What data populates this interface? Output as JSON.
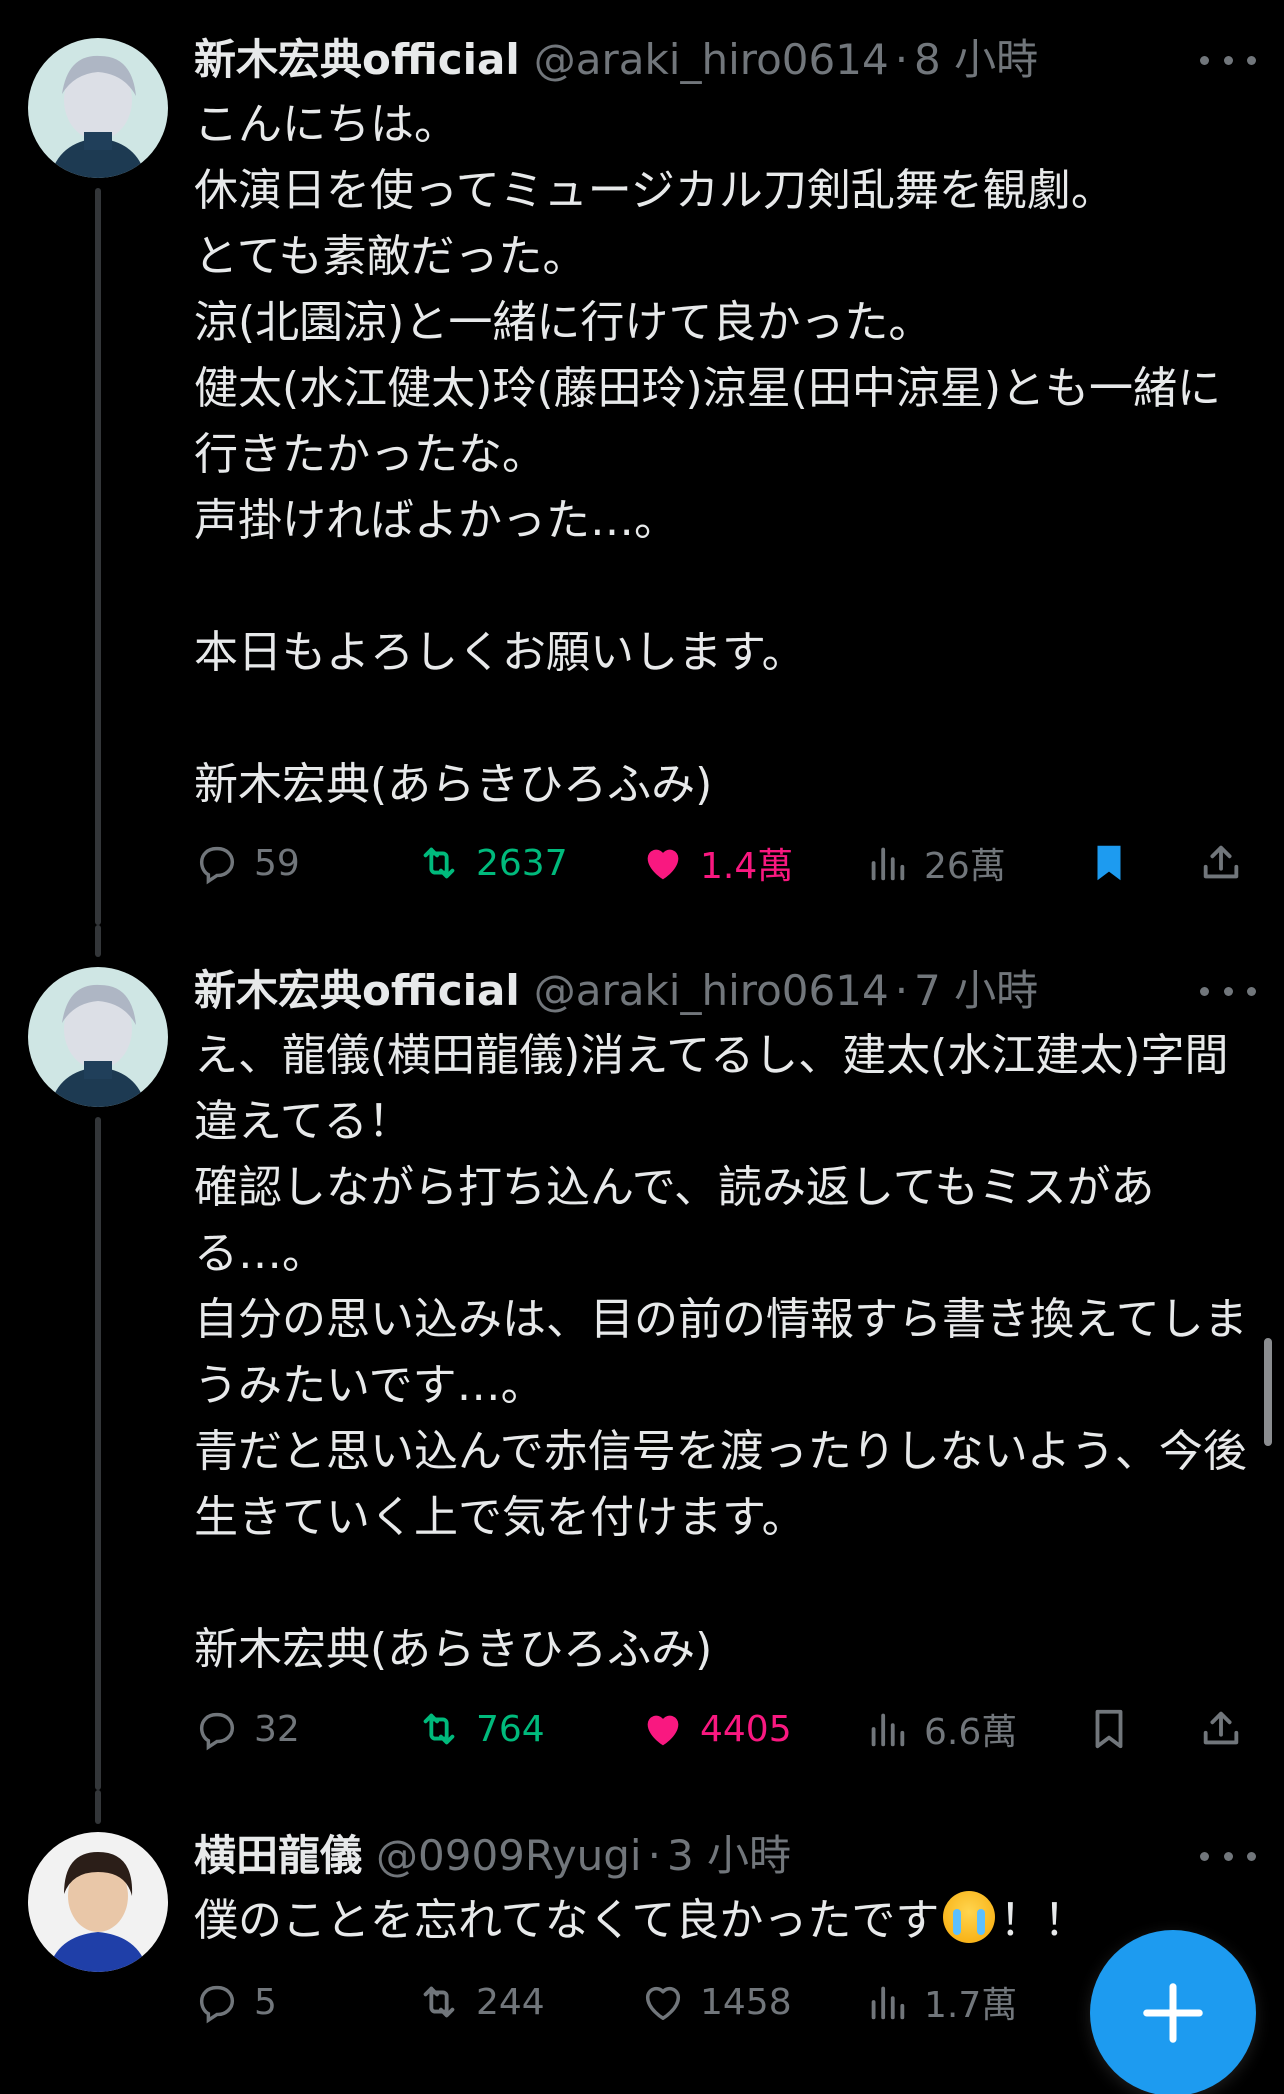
{
  "colors": {
    "background": "#000000",
    "text_primary": "#e7e9ea",
    "text_secondary": "#71767b",
    "retweet_green": "#00ba7c",
    "like_pink": "#f91880",
    "bookmark_blue": "#1d9bf0",
    "fab_blue": "#1d9bf0"
  },
  "tweets": [
    {
      "name": "新木宏典official",
      "handle": "@araki_hiro0614",
      "separator": "·",
      "time": "8 小時",
      "body": "こんにちは。\n休演日を使ってミュージカル刀剣乱舞を観劇。\nとても素敵だった。\n涼(北園涼)と一緒に行けて良かった。\n健太(水江健太)玲(藤田玲)涼星(田中涼星)とも一緒に行きたかったな。\n声掛ければよかった…。\n\n本日もよろしくお願いします。\n\n新木宏典(あらきひろふみ)",
      "replies": "59",
      "retweets": "2637",
      "likes": "1.4萬",
      "views": "26萬",
      "liked": true,
      "retweeted": true,
      "bookmarked": true,
      "avatar_icon": "avatar-silver-hair-icon"
    },
    {
      "name": "新木宏典official",
      "handle": "@araki_hiro0614",
      "separator": "·",
      "time": "7 小時",
      "body": "え、龍儀(横田龍儀)消えてるし、建太(水江建太)字間違えてる！\n確認しながら打ち込んで、読み返してもミスがある…。\n自分の思い込みは、目の前の情報すら書き換えてしまうみたいです…。\n青だと思い込んで赤信号を渡ったりしないよう、今後生きていく上で気を付けます。\n\n新木宏典(あらきひろふみ)",
      "replies": "32",
      "retweets": "764",
      "likes": "4405",
      "views": "6.6萬",
      "liked": true,
      "retweeted": true,
      "bookmarked": false,
      "avatar_icon": "avatar-silver-hair-icon"
    },
    {
      "name": "横田龍儀",
      "handle": "@0909Ryugi",
      "separator": "·",
      "time": "3 小時",
      "body_before_emoji": "僕のことを忘れてなくて良かったです",
      "emoji": "loudly-crying-face-emoji",
      "body_after_emoji": "！！",
      "replies": "5",
      "retweets": "244",
      "likes": "1458",
      "views": "1.7萬",
      "liked": false,
      "retweeted": false,
      "bookmarked": false,
      "avatar_icon": "avatar-dark-hair-icon"
    }
  ]
}
